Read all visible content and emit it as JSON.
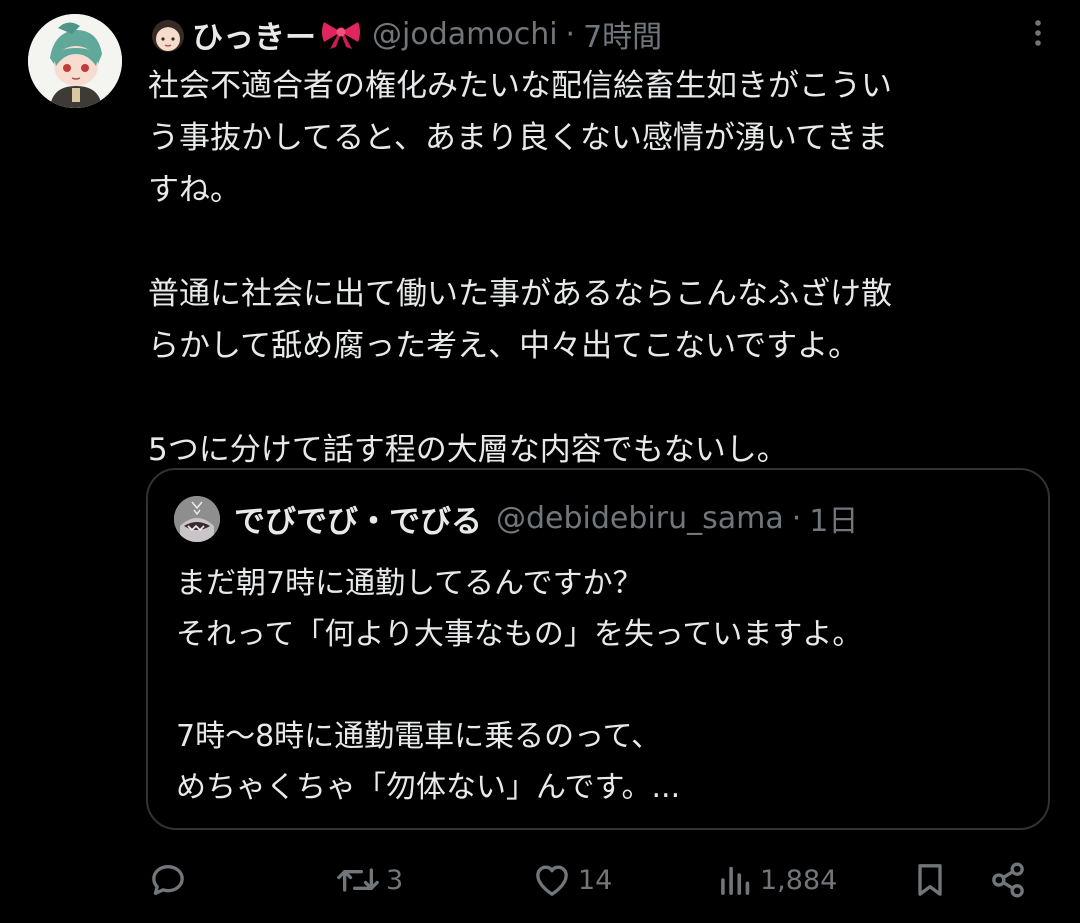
{
  "tweet": {
    "display_name": "ひっきー",
    "handle": "@jodamochi",
    "separator": "·",
    "time": "7時間",
    "lines": [
      "社会不適合者の権化みたいな配信絵畜生如きがこうい",
      "う事抜かしてると、あまり良くない感情が湧いてきま",
      "すね。",
      "",
      "普通に社会に出て働いた事があるならこんなふざけ散",
      "らかして舐め腐った考え、中々出てこないですよ。",
      "",
      "5つに分けて話す程の大層な内容でもないし。"
    ]
  },
  "quote": {
    "display_name": "でびでび・でびる",
    "handle": "@debidebiru_sama",
    "separator": "·",
    "time": "1日",
    "lines": [
      "まだ朝7時に通勤してるんですか？",
      "それって「何より大事なもの」を失っていますよ。",
      "",
      "7時〜8時に通勤電車に乗るのって、",
      "めちゃくちゃ「勿体ない」んです。..."
    ]
  },
  "actions": {
    "reply_count": "",
    "retweet_count": "3",
    "like_count": "14",
    "view_count": "1,884"
  },
  "icons": {
    "header": [
      "girl-face-emoji-icon",
      "ribbon-emoji-icon",
      "more-options-icon"
    ],
    "actions": [
      "reply-icon",
      "retweet-icon",
      "like-icon",
      "views-icon",
      "bookmark-icon",
      "share-icon"
    ]
  },
  "colors": {
    "background": "#000000",
    "text": "#e7e9ea",
    "secondary": "#71767b",
    "border": "#2f3336",
    "ribbon": "#e0245e"
  }
}
